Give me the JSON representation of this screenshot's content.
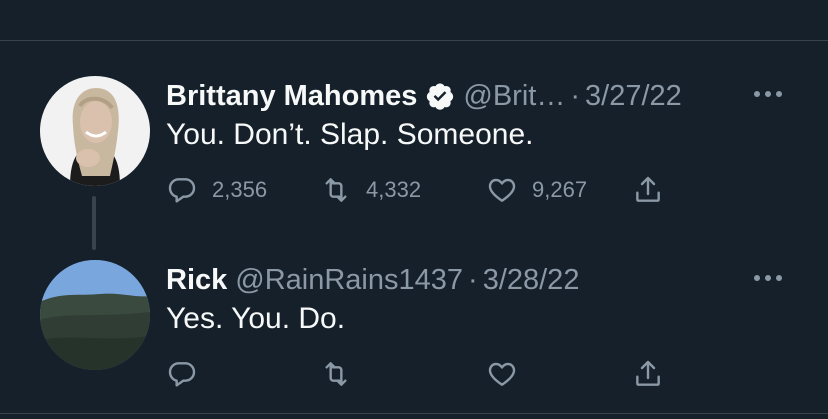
{
  "tweets": [
    {
      "display_name": "Brittany Mahomes",
      "verified": true,
      "handle": "@Brit…",
      "separator": "·",
      "date": "3/27/22",
      "text": "You. Don’t. Slap. Someone.",
      "reply_count": "2,356",
      "retweet_count": "4,332",
      "like_count": "9,267",
      "avatar_icon": "portrait-avatar"
    },
    {
      "display_name": "Rick",
      "verified": false,
      "handle": "@RainRains1437",
      "separator": "·",
      "date": "3/28/22",
      "text": "Yes. You. Do.",
      "reply_count": "",
      "retweet_count": "",
      "like_count": "",
      "avatar_icon": "landscape-avatar"
    }
  ],
  "colors": {
    "background": "#15202b",
    "primary_text": "#f7f9f9",
    "secondary_text": "#8b98a5",
    "divider": "#38444d",
    "verified_badge": "#f7f9f9"
  },
  "icons": {
    "reply": "reply-icon",
    "retweet": "retweet-icon",
    "like": "heart-icon",
    "share": "share-icon",
    "more": "more-icon",
    "verified": "verified-badge-icon"
  }
}
